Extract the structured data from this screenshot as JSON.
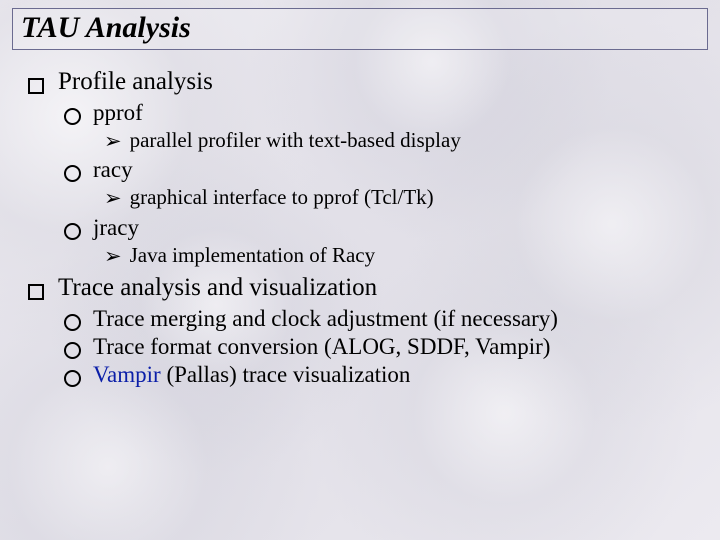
{
  "title": "TAU Analysis",
  "sections": [
    {
      "heading": "Profile analysis",
      "items": [
        {
          "name": "pprof",
          "desc": "parallel profiler with text-based display"
        },
        {
          "name": "racy",
          "desc": "graphical interface to pprof (Tcl/Tk)"
        },
        {
          "name": "jracy",
          "desc": "Java implementation of Racy"
        }
      ]
    },
    {
      "heading": "Trace analysis and visualization",
      "bullets": [
        {
          "text": "Trace merging and clock adjustment (if necessary)"
        },
        {
          "text": "Trace format conversion (ALOG, SDDF, Vampir)"
        },
        {
          "link": "Vampir",
          "text": " (Pallas) trace visualization"
        }
      ]
    }
  ],
  "glyphs": {
    "arrow": "➢"
  }
}
